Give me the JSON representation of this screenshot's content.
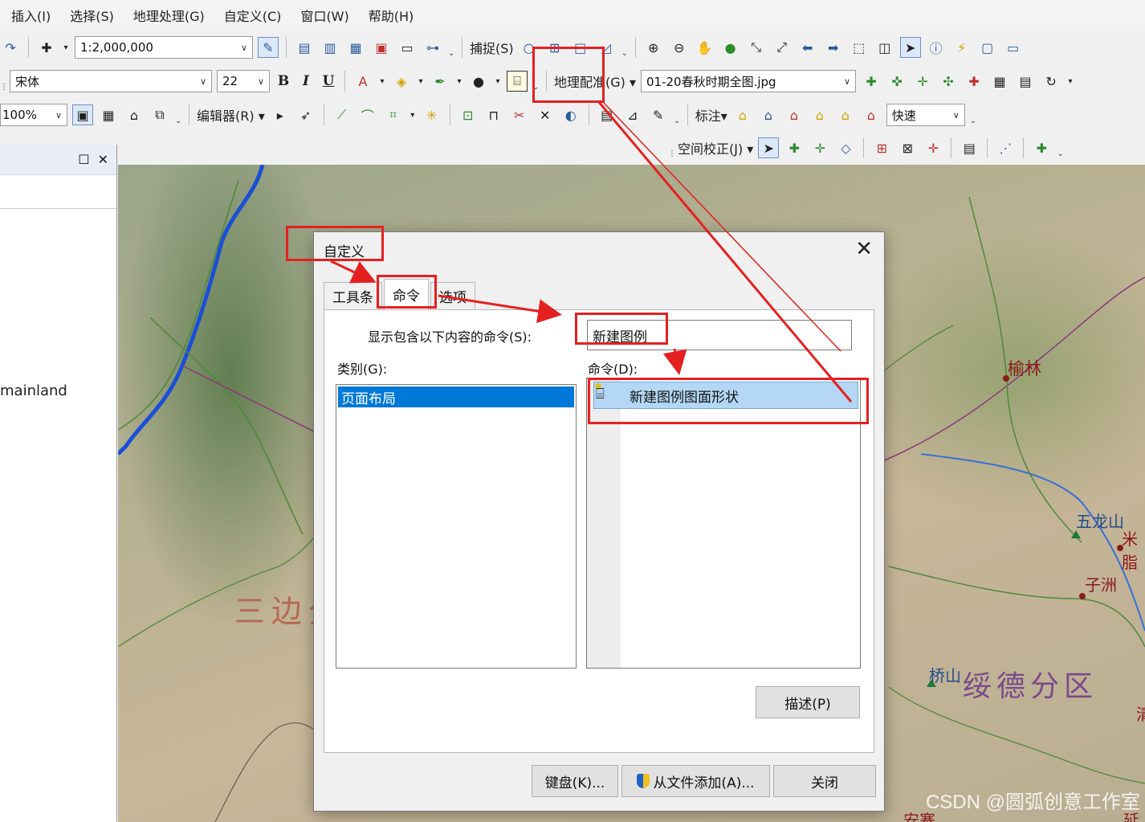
{
  "menubar": {
    "items": [
      "插入(I)",
      "选择(S)",
      "地理处理(G)",
      "自定义(C)",
      "窗口(W)",
      "帮助(H)"
    ]
  },
  "toolbar1": {
    "scale_value": "1:2,000,000",
    "snap_label": "捕捉(S)"
  },
  "toolbar2": {
    "font_name": "宋体",
    "font_size": "22",
    "bold": "B",
    "italic": "I",
    "underline": "U",
    "georef_label": "地理配准(G)",
    "georef_layer": "01-20春秋时期全图.jpg"
  },
  "toolbar3": {
    "zoom_value": "100%",
    "editor_label": "编辑器(R)",
    "label_menu": "标注",
    "quick_value": "快速"
  },
  "toolbar4": {
    "spatial_adjust_label": "空间校正(J)"
  },
  "left_panel": {
    "text": "mainland"
  },
  "map": {
    "labels": {
      "yulin": "榆林",
      "wulongshan": "五龙山",
      "mi": "米脂",
      "zizhou": "子洲",
      "sanbian": "三边分",
      "qiaoshan": "桥山",
      "suide": "绥德分区",
      "qing": "清",
      "anzhai": "安寨",
      "yan": "延"
    }
  },
  "dialog": {
    "title": "自定义",
    "tabs": [
      "工具条",
      "命令",
      "选项"
    ],
    "search_label": "显示包含以下内容的命令(S):",
    "search_value": "新建图例",
    "category_label": "类别(G):",
    "categories": [
      "页面布局"
    ],
    "commands_label": "命令(D):",
    "commands": [
      "新建图例图面形状"
    ],
    "describe_button": "描述(P)",
    "keyboard_button": "键盘(K)...",
    "add_from_file_button": "从文件添加(A)...",
    "close_button": "关闭"
  },
  "watermark": "CSDN @圆弧创意工作室",
  "colors": {
    "annotation_red": "#e52020",
    "selection_blue": "#0078d7",
    "command_highlight": "#b4d7f5",
    "map_label_red": "#8b1a1a"
  }
}
